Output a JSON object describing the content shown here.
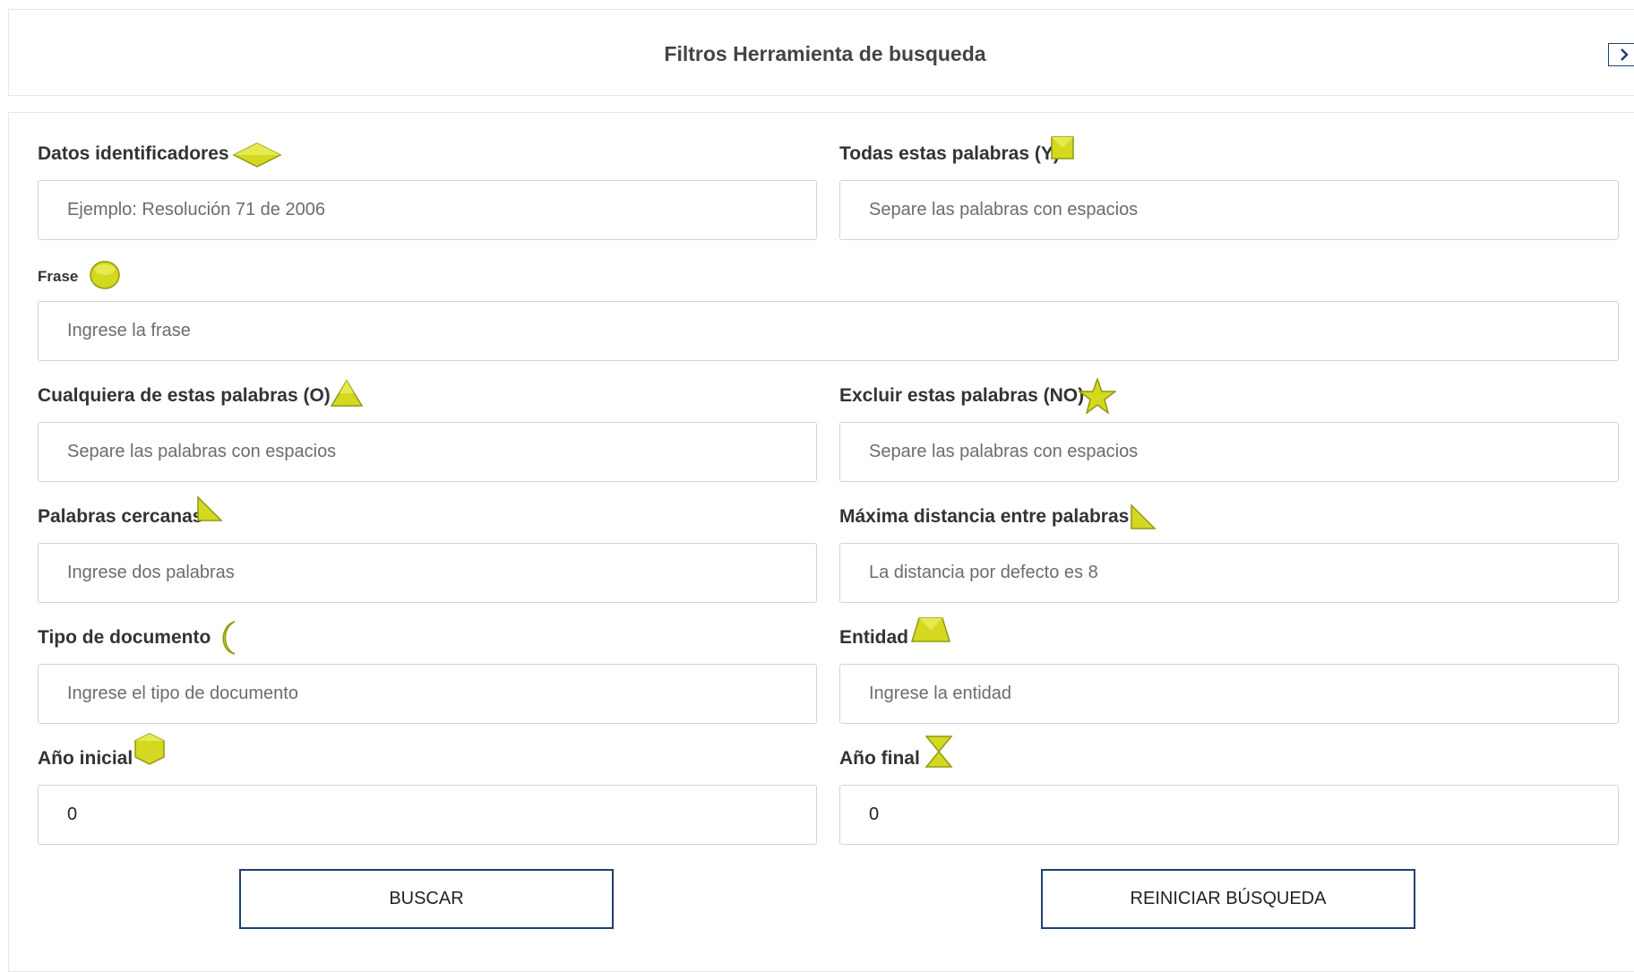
{
  "header": {
    "title": "Filtros Herramienta de busqueda",
    "collapse_icon": "chevron-right-icon"
  },
  "colors": {
    "shape_fill": "#d4d820",
    "shape_dark": "#8e9a10",
    "button_border": "#1f3f6e"
  },
  "fields": {
    "datos": {
      "label": "Datos identificadores",
      "placeholder": "Ejemplo: Resolución 71 de 2006",
      "icon": "diamond-icon"
    },
    "todas": {
      "label": "Todas estas palabras (Y)",
      "placeholder": "Separe las palabras con espacios",
      "icon": "square-icon"
    },
    "frase": {
      "label": "Frase",
      "placeholder": "Ingrese la frase",
      "icon": "circle-icon"
    },
    "cualquiera": {
      "label": "Cualquiera de estas palabras (O)",
      "placeholder": "Separe las palabras con espacios",
      "icon": "triangle-icon"
    },
    "excluir": {
      "label": "Excluir estas palabras (NO)",
      "placeholder": "Separe las palabras con espacios",
      "icon": "star-icon"
    },
    "cercanas": {
      "label": "Palabras cercanas",
      "placeholder": "Ingrese dos palabras",
      "icon": "right-triangle-icon"
    },
    "distancia": {
      "label": "Máxima distancia entre palabras",
      "placeholder": "La distancia por defecto es 8",
      "icon": "right-triangle-icon"
    },
    "tipo": {
      "label": "Tipo de documento",
      "placeholder": "Ingrese el tipo de documento",
      "icon": "crescent-moon-icon"
    },
    "entidad": {
      "label": "Entidad",
      "placeholder": "Ingrese la entidad",
      "icon": "trapezoid-icon"
    },
    "anio_inicial": {
      "label": "Año inicial",
      "value": "0",
      "icon": "hexagon-icon"
    },
    "anio_final": {
      "label": "Año final",
      "value": "0",
      "icon": "hourglass-icon"
    }
  },
  "buttons": {
    "search": "BUSCAR",
    "reset": "REINICIAR BÚSQUEDA"
  }
}
